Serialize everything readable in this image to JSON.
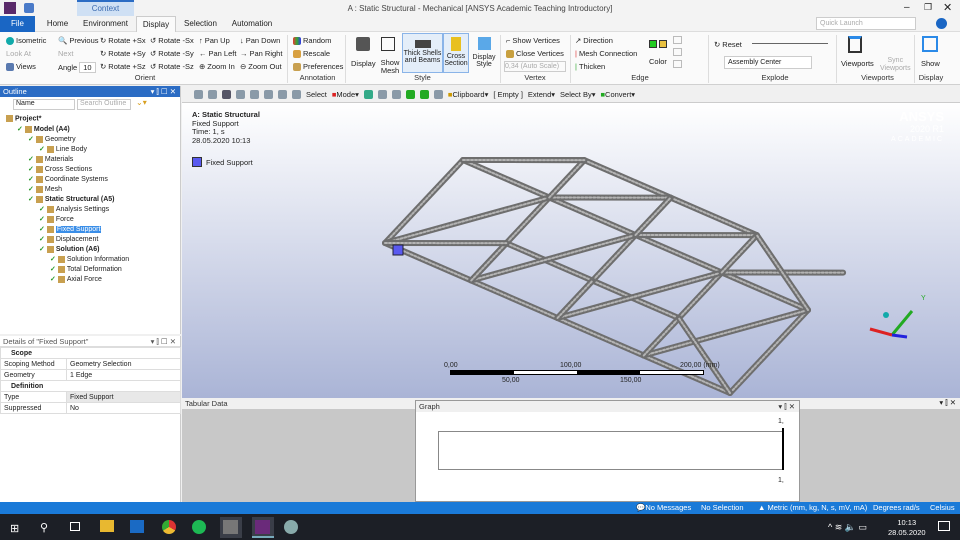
{
  "window": {
    "title": "A : Static Structural - Mechanical [ANSYS Academic Teaching Introductory]",
    "context": "Context",
    "quick_launch": "Quick Launch"
  },
  "tabs": [
    "File",
    "Home",
    "Environment",
    "Display",
    "Selection",
    "Automation"
  ],
  "ribbon": {
    "orient": {
      "items": [
        "Isometric",
        "Look At",
        "Views",
        "Previous",
        "Next",
        "Angle",
        "Rotate +Sx",
        "Rotate +Sy",
        "Rotate +Sz",
        "Rotate -Sx",
        "Rotate -Sy",
        "Rotate -Sz",
        "Pan Up",
        "Pan Left",
        "Zoom In",
        "Pan Down",
        "Pan Right",
        "Zoom Out"
      ],
      "angle_value": "10",
      "label": "Orient"
    },
    "annotation": {
      "items": [
        "Random",
        "Rescale",
        "Preferences"
      ],
      "label": "Annotation"
    },
    "style": {
      "items": [
        "Display",
        "Show Mesh",
        "Thick Shells and Beams",
        "Cross Section",
        "Display Style"
      ],
      "label": "Style"
    },
    "vertex": {
      "items": [
        "Show Vertices",
        "Close Vertices"
      ],
      "scale": "0,34 (Auto Scale)",
      "label": "Vertex"
    },
    "edge": {
      "items": [
        "Direction",
        "Mesh Connection",
        "Thicken",
        "Color"
      ],
      "label": "Edge"
    },
    "explode": {
      "reset": "Reset",
      "center": "Assembly Center",
      "label": "Explode"
    },
    "viewports": {
      "items": [
        "Viewports",
        "Sync Viewports"
      ],
      "label": "Viewports"
    },
    "display": {
      "items": [
        "Show"
      ],
      "label": "Display"
    }
  },
  "toolbar": {
    "select": "Select",
    "mode": "Mode",
    "clipboard": "Clipboard",
    "empty": "[ Empty ]",
    "extend": "Extend",
    "select_by": "Select By",
    "convert": "Convert"
  },
  "outline": {
    "title": "Outline",
    "filter": "Name",
    "search_placeholder": "Search Outline",
    "tree": [
      {
        "label": "Project*",
        "level": 0,
        "bold": true
      },
      {
        "label": "Model (A4)",
        "level": 1,
        "bold": true
      },
      {
        "label": "Geometry",
        "level": 2
      },
      {
        "label": "Line Body",
        "level": 3
      },
      {
        "label": "Materials",
        "level": 2
      },
      {
        "label": "Cross Sections",
        "level": 2
      },
      {
        "label": "Coordinate Systems",
        "level": 2
      },
      {
        "label": "Mesh",
        "level": 2
      },
      {
        "label": "Static Structural (A5)",
        "level": 2,
        "bold": true
      },
      {
        "label": "Analysis Settings",
        "level": 3
      },
      {
        "label": "Force",
        "level": 3
      },
      {
        "label": "Fixed Support",
        "level": 3,
        "selected": true
      },
      {
        "label": "Displacement",
        "level": 3
      },
      {
        "label": "Solution (A6)",
        "level": 3,
        "bold": true
      },
      {
        "label": "Solution Information",
        "level": 4
      },
      {
        "label": "Total Deformation",
        "level": 4
      },
      {
        "label": "Axial Force",
        "level": 4
      }
    ]
  },
  "details": {
    "title": "Details of \"Fixed Support\"",
    "sections": [
      {
        "name": "Scope",
        "rows": [
          [
            "Scoping Method",
            "Geometry Selection"
          ],
          [
            "Geometry",
            "1 Edge"
          ]
        ]
      },
      {
        "name": "Definition",
        "rows": [
          [
            "Type",
            "Fixed Support"
          ],
          [
            "Suppressed",
            "No"
          ]
        ]
      }
    ]
  },
  "viewport": {
    "analysis": "A: Static Structural",
    "object": "Fixed Support",
    "time": "Time: 1, s",
    "date": "28.05.2020 10:13",
    "legend": "Fixed Support",
    "legend_color": "#5a5af0",
    "logo": {
      "brand": "ANSYS",
      "version": "2020 R1",
      "edition": "ACADEMIC"
    },
    "scale_top": [
      "0,00",
      "100,00",
      "200,00 (mm)"
    ],
    "scale_bottom": [
      "50,00",
      "150,00"
    ],
    "axis_y": "Y"
  },
  "tabular": {
    "title": "Tabular Data"
  },
  "graph": {
    "title": "Graph",
    "y_top": "1,",
    "y_bottom": "1,"
  },
  "status": {
    "messages": "No Messages",
    "selection": "No Selection",
    "units": "Metric (mm, kg, N, s, mV, mA)",
    "angle": "Degrees",
    "rot": "rad/s",
    "temp": "Celsius"
  },
  "taskbar": {
    "time": "10:13",
    "date": "28.05.2020"
  }
}
